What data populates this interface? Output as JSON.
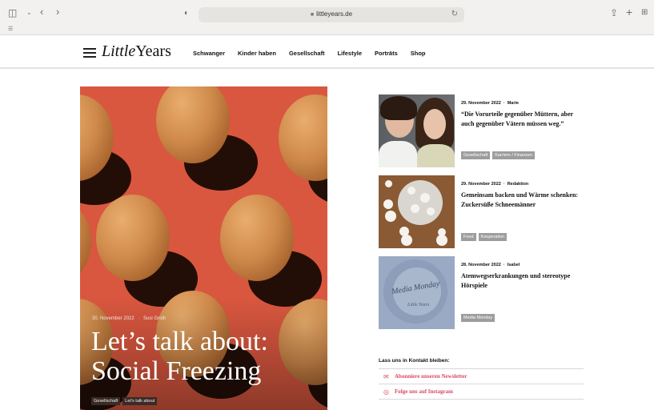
{
  "browser": {
    "url": "littleyears.de"
  },
  "site": {
    "logo_part1": "Little",
    "logo_part2": "Years",
    "nav": [
      "Schwanger",
      "Kinder haben",
      "Gesellschaft",
      "Lifestyle",
      "Porträts",
      "Shop"
    ]
  },
  "hero": {
    "date": "30. November 2022",
    "author": "Susi Groth",
    "title_line1": "Let’s talk about:",
    "title_line2": "Social Freezing",
    "tags": [
      "Gesellschaft",
      "Let’s talk about"
    ]
  },
  "articles": [
    {
      "date": "29. November 2022",
      "author": "Marie",
      "title": "“Die Vorurteile gegenüber Müttern, aber auch gegenüber Vätern müssen weg.”",
      "tags": [
        "Gesellschaft",
        "Karriere / Finanzen"
      ]
    },
    {
      "date": "29. November 2022",
      "author": "Redaktion",
      "title": "Gemeinsam backen und Wärme schenken: Zuckersüße Schneemänner",
      "tags": [
        "Food",
        "Kooperation"
      ]
    },
    {
      "date": "28. November 2022",
      "author": "Isabel",
      "title": "Atemwegserkrankungen und stereotype Hörspiele",
      "tags": [
        "Media Monday"
      ],
      "thumb_text": "Media Monday",
      "thumb_subtext": "Little Years"
    }
  ],
  "contact": {
    "title": "Lass uns in Kontakt bleiben:",
    "items": [
      {
        "icon": "mail-icon",
        "label": "Abonniere unseren Newsletter"
      },
      {
        "icon": "instagram-icon",
        "label": "Folge uns auf Instagram"
      }
    ]
  },
  "colors": {
    "hero_bg": "#d9573f",
    "accent": "#d94a62"
  }
}
